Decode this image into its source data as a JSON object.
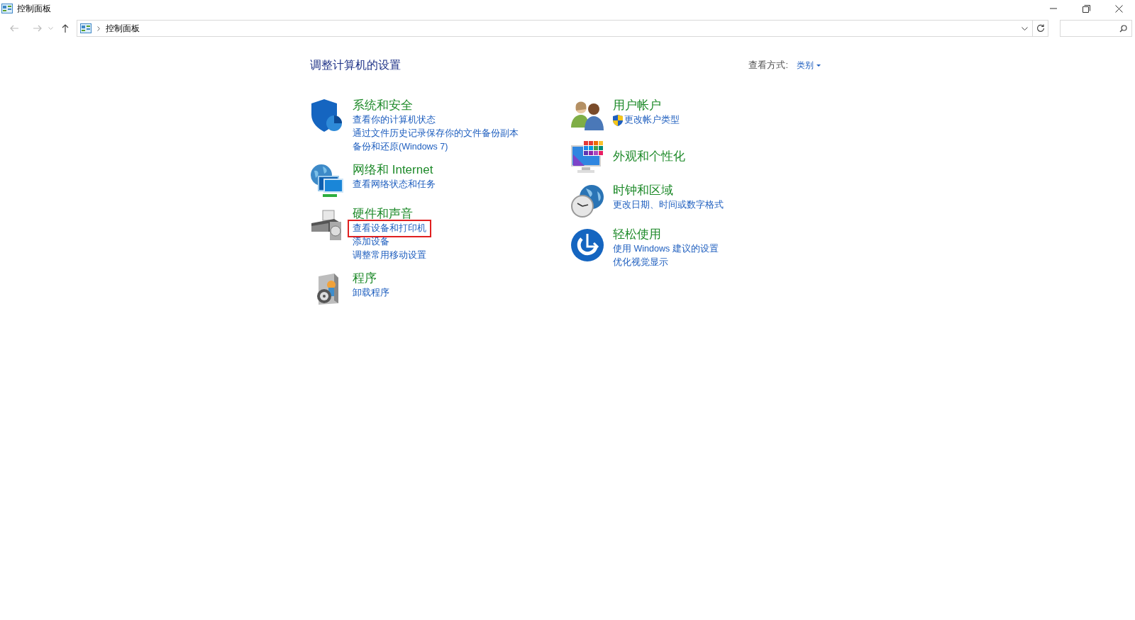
{
  "window": {
    "title": "控制面板"
  },
  "address_bar": {
    "path": "控制面板"
  },
  "heading": "调整计算机的设置",
  "view_by": {
    "label": "查看方式:",
    "value": "类别"
  },
  "columns": [
    [
      {
        "kind": "security",
        "title": "系统和安全",
        "links": [
          {
            "text": "查看你的计算机状态",
            "highlighted": false,
            "shield": false
          },
          {
            "text": "通过文件历史记录保存你的文件备份副本",
            "highlighted": false,
            "shield": false
          },
          {
            "text": "备份和还原(Windows 7)",
            "highlighted": false,
            "shield": false
          }
        ]
      },
      {
        "kind": "network",
        "title": "网络和 Internet",
        "links": [
          {
            "text": "查看网络状态和任务",
            "highlighted": false,
            "shield": false
          }
        ]
      },
      {
        "kind": "hardware",
        "title": "硬件和声音",
        "links": [
          {
            "text": "查看设备和打印机",
            "highlighted": true,
            "shield": false
          },
          {
            "text": "添加设备",
            "highlighted": false,
            "shield": false
          },
          {
            "text": "调整常用移动设置",
            "highlighted": false,
            "shield": false
          }
        ]
      },
      {
        "kind": "programs",
        "title": "程序",
        "links": [
          {
            "text": "卸载程序",
            "highlighted": false,
            "shield": false
          }
        ]
      }
    ],
    [
      {
        "kind": "users",
        "title": "用户帐户",
        "links": [
          {
            "text": "更改帐户类型",
            "highlighted": false,
            "shield": true
          }
        ]
      },
      {
        "kind": "appearance",
        "title": "外观和个性化"
      },
      {
        "kind": "clock",
        "title": "时钟和区域",
        "links": [
          {
            "text": "更改日期、时间或数字格式",
            "highlighted": false,
            "shield": false
          }
        ]
      },
      {
        "kind": "ease",
        "title": "轻松使用",
        "links": [
          {
            "text": "使用 Windows 建议的设置",
            "highlighted": false,
            "shield": false
          },
          {
            "text": "优化视觉显示",
            "highlighted": false,
            "shield": false
          }
        ]
      }
    ]
  ]
}
